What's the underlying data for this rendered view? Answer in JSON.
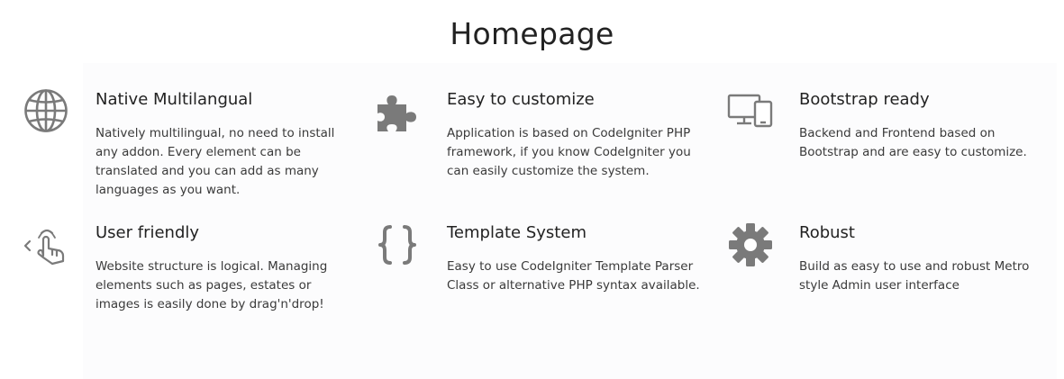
{
  "page": {
    "title": "Homepage"
  },
  "colors": {
    "icon": "#7a7a7a",
    "text": "#3a3a3a",
    "heading": "#222222"
  },
  "features": [
    {
      "icon": "globe-icon",
      "title": "Native Multilangual",
      "description": "Natively multilingual, no need to install any addon. Every element can be translated and you can add as many languages as you want."
    },
    {
      "icon": "puzzle-icon",
      "title": "Easy to customize",
      "description": "Application is based on CodeIgniter PHP framework, if you know CodeIgniter you can easily customize the system."
    },
    {
      "icon": "devices-icon",
      "title": "Bootstrap ready",
      "description": "Backend and Frontend based on Bootstrap and are easy to customize."
    },
    {
      "icon": "touch-hand-icon",
      "title": "User friendly",
      "description": "Website structure is logical. Managing elements such as pages, estates or images is easily done by drag'n'drop!"
    },
    {
      "icon": "curly-braces-icon",
      "title": "Template System",
      "description": "Easy to use CodeIgniter Template Parser Class or alternative PHP syntax available."
    },
    {
      "icon": "gear-icon",
      "title": "Robust",
      "description": "Build as easy to use and robust Metro style Admin user interface"
    }
  ]
}
